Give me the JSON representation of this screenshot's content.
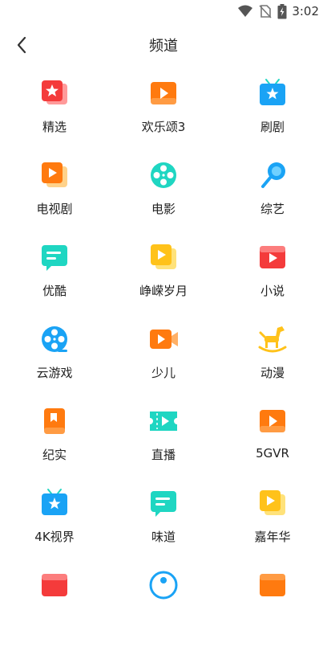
{
  "status_bar": {
    "time": "3:02"
  },
  "header": {
    "title": "频道"
  },
  "channels": [
    {
      "label": "精选",
      "icon": "star-badge-icon"
    },
    {
      "label": "欢乐颂3",
      "icon": "play-card-icon"
    },
    {
      "label": "刷剧",
      "icon": "tv-star-icon"
    },
    {
      "label": "电视剧",
      "icon": "play-card-stack-icon"
    },
    {
      "label": "电影",
      "icon": "film-reel-icon"
    },
    {
      "label": "综艺",
      "icon": "microphone-icon"
    },
    {
      "label": "优酷",
      "icon": "chat-card-icon"
    },
    {
      "label": "峥嵘岁月",
      "icon": "play-card-stack-icon"
    },
    {
      "label": "小说",
      "icon": "play-card-icon"
    },
    {
      "label": "云游戏",
      "icon": "film-reel-icon"
    },
    {
      "label": "少儿",
      "icon": "video-camera-icon"
    },
    {
      "label": "动漫",
      "icon": "rocking-horse-icon"
    },
    {
      "label": "纪实",
      "icon": "bookmark-card-icon"
    },
    {
      "label": "直播",
      "icon": "ticket-play-icon"
    },
    {
      "label": "5GVR",
      "icon": "play-card-icon"
    },
    {
      "label": "4K视界",
      "icon": "tv-star-icon"
    },
    {
      "label": "味道",
      "icon": "chat-card-icon"
    },
    {
      "label": "嘉年华",
      "icon": "play-card-stack-icon"
    }
  ],
  "colors": {
    "red": "#f43b3b",
    "orange": "#ff7a0f",
    "blue": "#1aa3f5",
    "teal": "#1fd6c2",
    "yellow": "#ffc21a"
  }
}
